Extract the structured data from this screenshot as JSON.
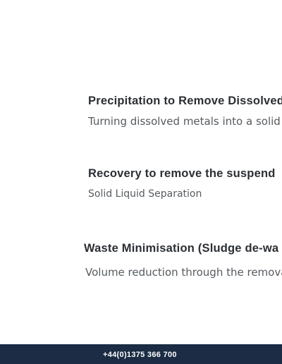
{
  "sections": [
    {
      "heading": "Precipitation to Remove Dissolved",
      "text": "Turning dissolved metals into a solid fo"
    },
    {
      "heading": "Recovery to remove the suspend",
      "text": "Solid Liquid Separation"
    },
    {
      "heading": "Waste Minimisation (Sludge de-wa",
      "text": "Volume reduction through the remova"
    }
  ],
  "footer": {
    "phone": "+44(0)1375 366 700"
  },
  "colors": {
    "heading": "#2b2f33",
    "text": "#555b60",
    "footer_bg": "#1b2c44",
    "footer_text": "#ffffff"
  }
}
